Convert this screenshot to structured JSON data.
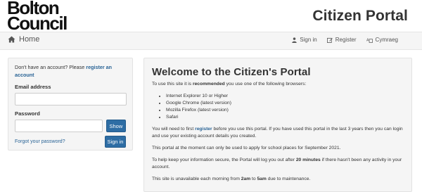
{
  "header": {
    "logo_line1": "Bolton",
    "logo_line2": "Council",
    "portal_title": "Citizen Portal"
  },
  "nav": {
    "home_label": "Home",
    "signin_label": "Sign in",
    "register_label": "Register",
    "cymraeg_label": "Cymraeg"
  },
  "login": {
    "prompt_text": "Don't have an account? Please",
    "register_link": "register an account",
    "email_label": "Email address",
    "email_value": "",
    "password_label": "Password",
    "password_value": "",
    "show_button": "Show",
    "forgot_link": "Forgot your password?",
    "signin_button": "Sign in"
  },
  "main": {
    "title": "Welcome to the Citizen's Portal",
    "intro_prefix": "To use this site it is",
    "intro_bold": "recommended",
    "intro_suffix": "you use one of the following browsers:",
    "browsers": [
      "Internet Explorer 10 or Higher",
      "Google Chrome (latest version)",
      "Mozilla Firefox (latest version)",
      "Safari"
    ],
    "register_prefix": "You will need to first",
    "register_link": "register",
    "register_suffix": "before you use this portal. If you have used this portal in the last 3 years then you can login and use your existing account details you created.",
    "school_places": "This portal at the moment can only be used to apply for school places for September 2021.",
    "security_prefix": "To help keep your information secure, the Portal will log you out after",
    "security_bold": "20 minutes",
    "security_suffix": "if there hasn't been any activity in your account.",
    "maintenance_prefix": "This site is unavailable each morning from",
    "maintenance_from": "2am",
    "maintenance_to_word": "to",
    "maintenance_to": "5am",
    "maintenance_suffix": "due to maintenance."
  },
  "colors": {
    "link": "#2a6496",
    "button": "#2e6da4",
    "panel_bg": "#f5f5f5"
  },
  "icons": {
    "home": "home-icon",
    "signin": "user-icon",
    "register": "edit-icon",
    "cymraeg": "language-icon"
  }
}
